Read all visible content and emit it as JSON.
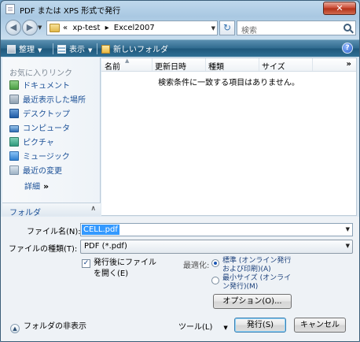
{
  "window": {
    "title": "PDF または XPS 形式で発行",
    "close_glyph": "✕"
  },
  "address_bar": {
    "breadcrumbs": [
      "«",
      "xp-test",
      "▸",
      "Excel2007"
    ],
    "refresh_glyph": "↻"
  },
  "search": {
    "placeholder": "検索"
  },
  "toolbar": {
    "organize_label": "整理",
    "views_label": "表示",
    "new_folder_label": "新しいフォルダ",
    "help_glyph": "?"
  },
  "favorites": {
    "header": "お気に入りリンク",
    "items": [
      {
        "label": "ドキュメント",
        "icon": "documents-icon"
      },
      {
        "label": "最近表示した場所",
        "icon": "recent-places-icon"
      },
      {
        "label": "デスクトップ",
        "icon": "desktop-icon"
      },
      {
        "label": "コンピュータ",
        "icon": "computer-icon"
      },
      {
        "label": "ピクチャ",
        "icon": "pictures-icon"
      },
      {
        "label": "ミュージック",
        "icon": "music-icon"
      },
      {
        "label": "最近の変更",
        "icon": "recently-changed-icon"
      }
    ],
    "more_label": "詳細",
    "more_glyph": "»"
  },
  "folders_bar": {
    "label": "フォルダ",
    "chevron": "∧"
  },
  "file_list": {
    "columns": [
      "名前",
      "更新日時",
      "種類",
      "サイズ"
    ],
    "more_columns": "»",
    "empty_message": "検索条件に一致する項目はありません。"
  },
  "form": {
    "filename_label": "ファイル名(N):",
    "filename_value": "CELL.pdf",
    "filetype_label": "ファイルの種類(T):",
    "filetype_value": "PDF (*.pdf)",
    "open_after_label": "発行後にファイルを開く(E)",
    "open_after_checked": true,
    "optimize_label": "最適化:",
    "optimize_standard": "標準 (オンライン発行および印刷)(A)",
    "optimize_minimum": "最小サイズ (オンライン発行)(M)",
    "optimize_selected": "standard",
    "options_button": "オプション(O)...",
    "tools_label": "ツール(L)",
    "publish_button": "発行(S)",
    "cancel_button": "キャンセル",
    "hide_folders_label": "フォルダの非表示"
  }
}
